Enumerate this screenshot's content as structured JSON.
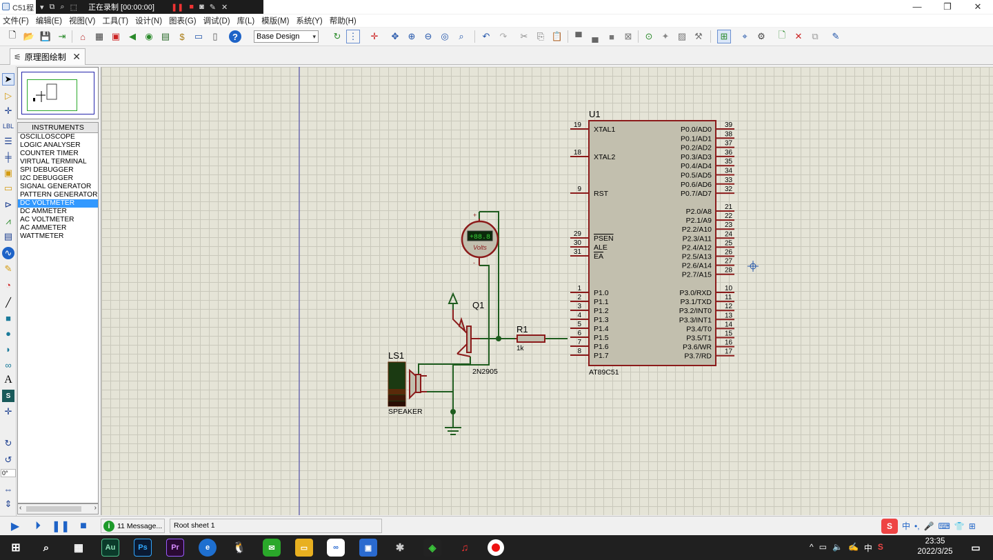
{
  "titlebar": {
    "app_title": "C51程",
    "recording_label": "正在录制 [00:00:00]"
  },
  "menu": [
    "文件(F)",
    "编辑(E)",
    "视图(V)",
    "工具(T)",
    "设计(N)",
    "图表(G)",
    "调试(D)",
    "库(L)",
    "模版(M)",
    "系统(Y)",
    "帮助(H)"
  ],
  "toolbar": {
    "design_select_value": "Base Design"
  },
  "tab": {
    "label": "原理图绘制"
  },
  "left_panel": {
    "header": "INSTRUMENTS",
    "items": [
      "OSCILLOSCOPE",
      "LOGIC ANALYSER",
      "COUNTER TIMER",
      "VIRTUAL TERMINAL",
      "SPI DEBUGGER",
      "I2C DEBUGGER",
      "SIGNAL GENERATOR",
      "PATTERN GENERATOR",
      "DC VOLTMETER",
      "DC AMMETER",
      "AC VOLTMETER",
      "AC AMMETER",
      "WATTMETER"
    ],
    "selected_item": "DC VOLTMETER",
    "rotation_value": "0°"
  },
  "schematic": {
    "mcu": {
      "ref": "U1",
      "part": "AT89C51",
      "left_pins": [
        {
          "num": "19",
          "name": "XTAL1"
        },
        {
          "num": "18",
          "name": "XTAL2"
        },
        {
          "num": "9",
          "name": "RST"
        },
        {
          "num": "29",
          "name": "PSEN"
        },
        {
          "num": "30",
          "name": "ALE"
        },
        {
          "num": "31",
          "name": "EA"
        },
        {
          "num": "1",
          "name": "P1.0"
        },
        {
          "num": "2",
          "name": "P1.1"
        },
        {
          "num": "3",
          "name": "P1.2"
        },
        {
          "num": "4",
          "name": "P1.3"
        },
        {
          "num": "5",
          "name": "P1.4"
        },
        {
          "num": "6",
          "name": "P1.5"
        },
        {
          "num": "7",
          "name": "P1.6"
        },
        {
          "num": "8",
          "name": "P1.7"
        }
      ],
      "right_pins": [
        {
          "num": "39",
          "name": "P0.0/AD0"
        },
        {
          "num": "38",
          "name": "P0.1/AD1"
        },
        {
          "num": "37",
          "name": "P0.2/AD2"
        },
        {
          "num": "36",
          "name": "P0.3/AD3"
        },
        {
          "num": "35",
          "name": "P0.4/AD4"
        },
        {
          "num": "34",
          "name": "P0.5/AD5"
        },
        {
          "num": "33",
          "name": "P0.6/AD6"
        },
        {
          "num": "32",
          "name": "P0.7/AD7"
        },
        {
          "num": "21",
          "name": "P2.0/A8"
        },
        {
          "num": "22",
          "name": "P2.1/A9"
        },
        {
          "num": "23",
          "name": "P2.2/A10"
        },
        {
          "num": "24",
          "name": "P2.3/A11"
        },
        {
          "num": "25",
          "name": "P2.4/A12"
        },
        {
          "num": "26",
          "name": "P2.5/A13"
        },
        {
          "num": "27",
          "name": "P2.6/A14"
        },
        {
          "num": "28",
          "name": "P2.7/A15"
        },
        {
          "num": "10",
          "name": "P3.0/RXD"
        },
        {
          "num": "11",
          "name": "P3.1/TXD"
        },
        {
          "num": "12",
          "name": "P3.2/INT0"
        },
        {
          "num": "13",
          "name": "P3.3/INT1"
        },
        {
          "num": "14",
          "name": "P3.4/T0"
        },
        {
          "num": "15",
          "name": "P3.5/T1"
        },
        {
          "num": "16",
          "name": "P3.6/WR"
        },
        {
          "num": "17",
          "name": "P3.7/RD"
        }
      ]
    },
    "resistor": {
      "ref": "R1",
      "value": "1k"
    },
    "transistor": {
      "ref": "Q1",
      "part": "2N2905"
    },
    "speaker": {
      "ref": "LS1",
      "part": "SPEAKER"
    },
    "voltmeter": {
      "display": "+88.8",
      "unit": "Volts",
      "plus": "+",
      "minus": "-"
    }
  },
  "statusbar": {
    "messages": "11 Message...",
    "sheet": "Root sheet 1"
  },
  "taskbar": {
    "time": "23:35",
    "date": "2022/3/25",
    "ime_lang": "中"
  },
  "colors": {
    "canvas_bg": "#e5e4d7",
    "component_body": "#c2bfae",
    "component_outline": "#8b1a1a",
    "wire": "#1e5c1e",
    "selection": "#3399ff"
  }
}
